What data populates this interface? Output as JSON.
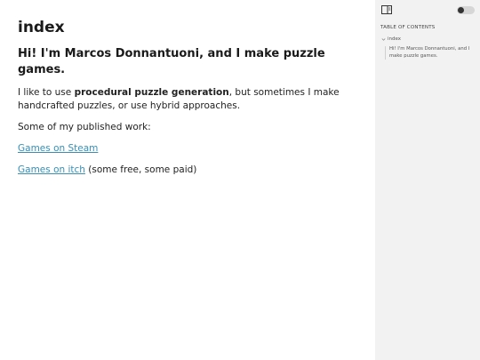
{
  "main": {
    "title": "index",
    "heading": "Hi! I'm Marcos Donnantuoni, and I make puzzle games.",
    "intro_before": "I like to use ",
    "intro_bold": "procedural puzzle generation",
    "intro_after": ", but sometimes I make handcrafted puzzles, or use hybrid approaches.",
    "published_label": "Some of my published work:",
    "link_steam": "Games on Steam",
    "link_itch": "Games on itch",
    "itch_note": " (some free, some paid)"
  },
  "sidebar": {
    "toc_heading": "TABLE OF CONTENTS",
    "toc_root": "index",
    "toc_sub": "Hi! I'm Marcos Donnantuoni, and I make puzzle games."
  },
  "colors": {
    "link": "#3a8fb7",
    "sidebar_bg": "#f2f2f2"
  },
  "icons": {
    "sidebar_toggle": "sidebar-toggle-icon",
    "toc_chevron": "chevron-down-icon"
  }
}
